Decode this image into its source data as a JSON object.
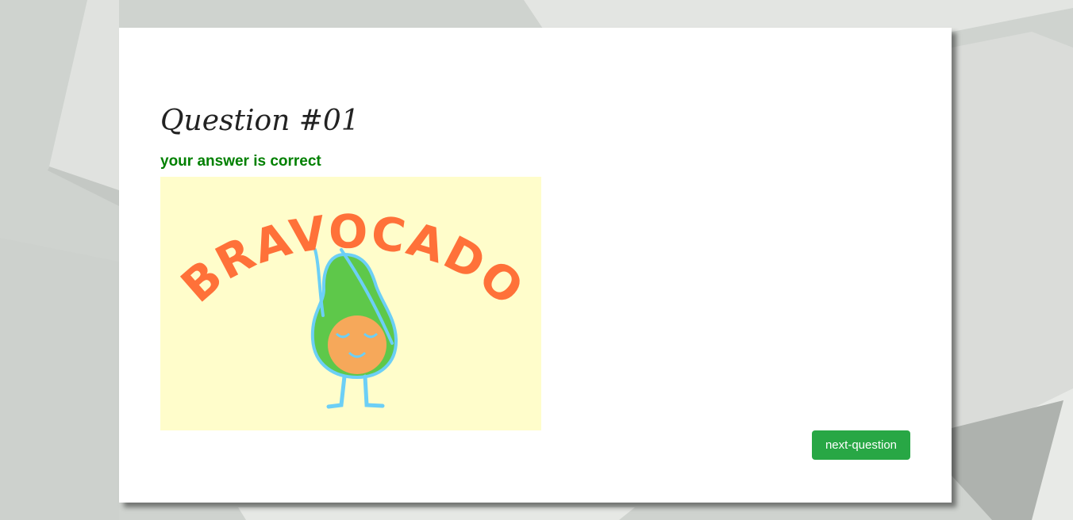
{
  "question": {
    "title": "Question #01",
    "feedback": "your answer is correct",
    "image": {
      "name": "bravocado-image",
      "text": "BRAVOCADO"
    }
  },
  "actions": {
    "next_label": "next-question"
  },
  "colors": {
    "feedback_green": "#008000",
    "button_green": "#28a745",
    "image_background": "#fffdcb",
    "lettering_orange": "#ff7139",
    "avocado_green": "#5ec84a",
    "pit_orange": "#f6a85a",
    "outline_blue": "#6ccff6"
  }
}
